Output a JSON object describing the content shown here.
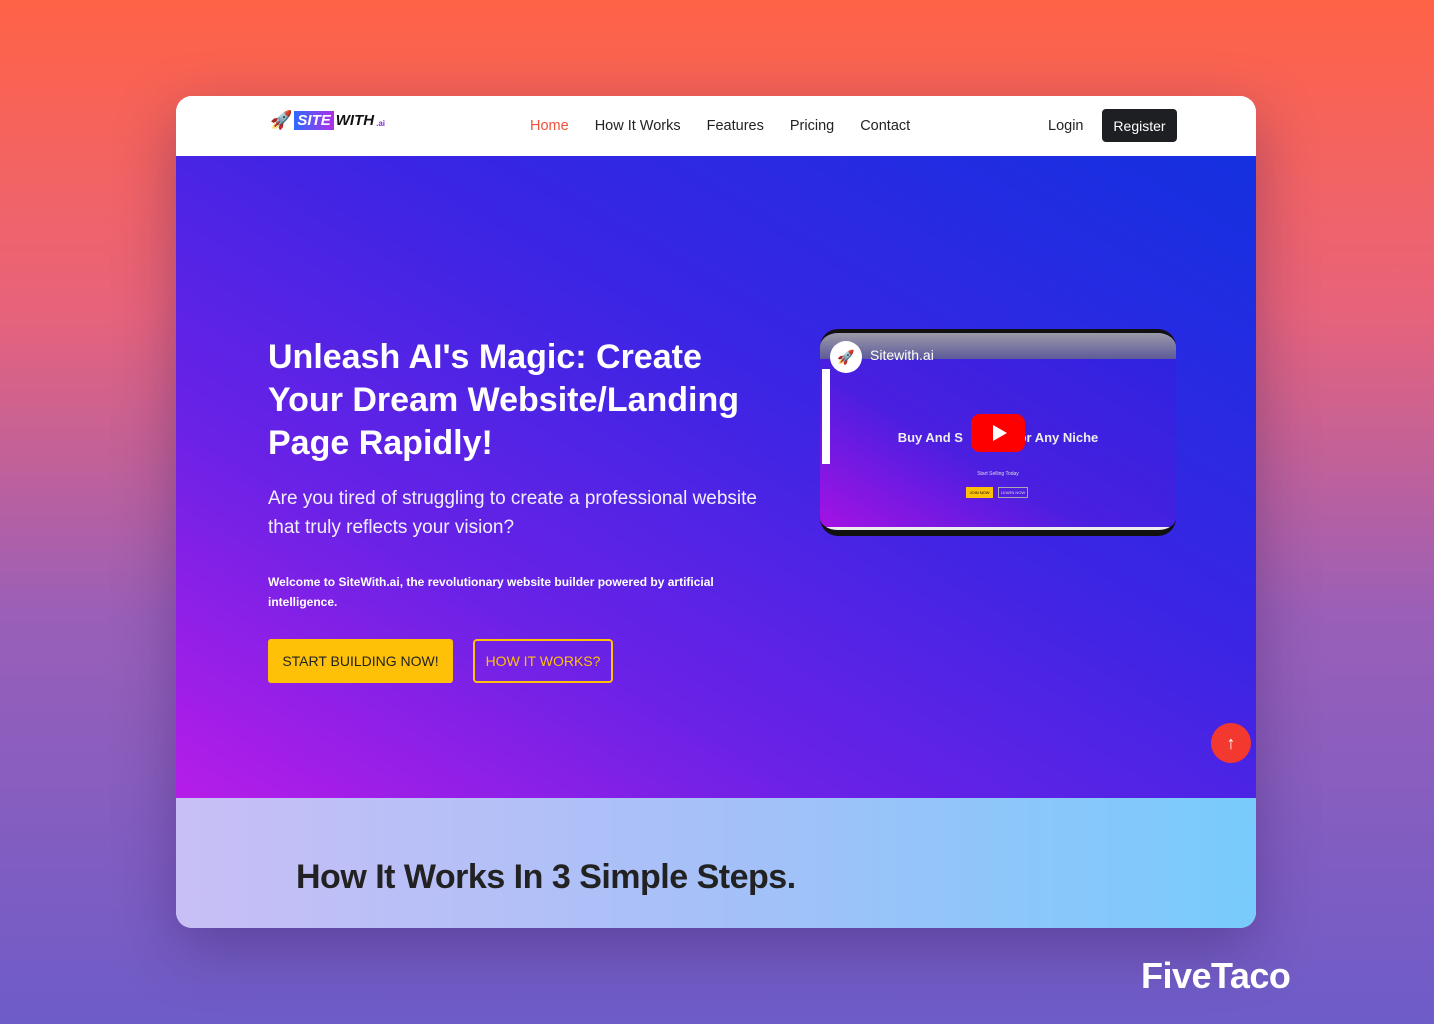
{
  "nav": {
    "logo_parts": [
      "SITE",
      "WITH",
      ".ai"
    ],
    "items": [
      "Home",
      "How It Works",
      "Features",
      "Pricing",
      "Contact"
    ],
    "active": "Home",
    "login": "Login",
    "register": "Register"
  },
  "hero": {
    "title": "Unleash AI's Magic: Create Your Dream Website/Landing Page Rapidly!",
    "subtitle": "Are you tired of struggling to create a professional website that truly reflects your vision?",
    "description": "Welcome to SiteWith.ai, the revolutionary website builder powered by artificial intelligence.",
    "primary_cta": "START BUILDING NOW!",
    "secondary_cta": "HOW IT WORKS?"
  },
  "video": {
    "channel": "Sitewith.ai",
    "headline": "Buy And S     ts For Any Niche",
    "tagline": "Start Selling Today",
    "btn1": "JOIN NOW",
    "btn2": "LEARN NOW",
    "icon": "youtube-play-icon"
  },
  "steps": {
    "title": "How It Works In 3 Simple Steps."
  },
  "watermark": "FiveTaco",
  "colors": {
    "accent": "#f0523a",
    "cta": "#ffc107",
    "totop": "#f2382f"
  }
}
